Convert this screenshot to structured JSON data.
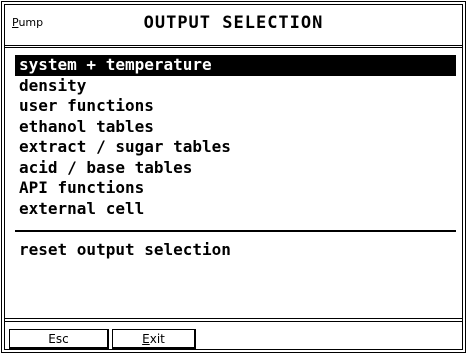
{
  "title_bar": {
    "app_label_first": "P",
    "app_label_rest": "ump",
    "title": "OUTPUT SELECTION"
  },
  "menu": {
    "items": [
      {
        "label": "system + temperature",
        "selected": true
      },
      {
        "label": "density"
      },
      {
        "label": "user functions"
      },
      {
        "label": "ethanol tables"
      },
      {
        "label": "extract / sugar tables"
      },
      {
        "label": "acid / base tables"
      },
      {
        "label": "API functions"
      },
      {
        "label": "external cell"
      }
    ],
    "reset_label": "reset output selection"
  },
  "footer": {
    "esc_label": "Esc",
    "exit_label_first": "E",
    "exit_label_rest": "xit"
  }
}
